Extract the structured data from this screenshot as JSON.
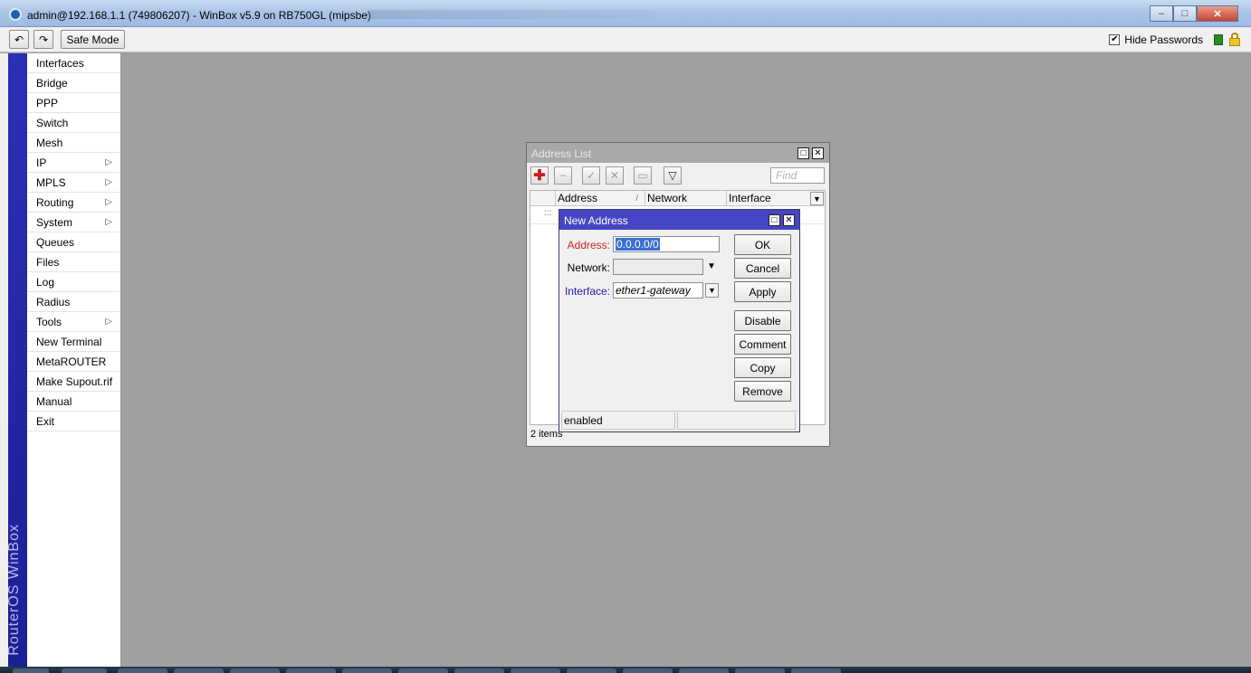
{
  "window": {
    "title": "admin@192.168.1.1 (749806207) - WinBox v5.9 on RB750GL (mipsbe)",
    "buttons": {
      "minimize": "–",
      "maximize": "□",
      "close": "✕"
    }
  },
  "toolbar": {
    "undo_icon": "↶",
    "redo_icon": "↷",
    "safe_mode_label": "Safe Mode",
    "hide_passwords_label": "Hide Passwords",
    "hide_passwords_checked": "✔"
  },
  "sidebar": {
    "brand": "RouterOS WinBox",
    "items": [
      {
        "label": "Interfaces",
        "submenu": ""
      },
      {
        "label": "Bridge",
        "submenu": ""
      },
      {
        "label": "PPP",
        "submenu": ""
      },
      {
        "label": "Switch",
        "submenu": ""
      },
      {
        "label": "Mesh",
        "submenu": ""
      },
      {
        "label": "IP",
        "submenu": "▷"
      },
      {
        "label": "MPLS",
        "submenu": "▷"
      },
      {
        "label": "Routing",
        "submenu": "▷"
      },
      {
        "label": "System",
        "submenu": "▷"
      },
      {
        "label": "Queues",
        "submenu": ""
      },
      {
        "label": "Files",
        "submenu": ""
      },
      {
        "label": "Log",
        "submenu": ""
      },
      {
        "label": "Radius",
        "submenu": ""
      },
      {
        "label": "Tools",
        "submenu": "▷"
      },
      {
        "label": "New Terminal",
        "submenu": ""
      },
      {
        "label": "MetaROUTER",
        "submenu": ""
      },
      {
        "label": "Make Supout.rif",
        "submenu": ""
      },
      {
        "label": "Manual",
        "submenu": ""
      },
      {
        "label": "Exit",
        "submenu": ""
      }
    ]
  },
  "address_list": {
    "title": "Address List",
    "find_placeholder": "Find",
    "columns": [
      "Address",
      "Network",
      "Interface"
    ],
    "sort_marker": "/",
    "row_marker": ":::",
    "status": "2 items"
  },
  "new_address": {
    "title": "New Address",
    "address_label": "Address:",
    "address_value": "0.0.0.0/0",
    "network_label": "Network:",
    "network_value": "",
    "interface_label": "Interface:",
    "interface_value": "ether1-gateway",
    "buttons": {
      "ok": "OK",
      "cancel": "Cancel",
      "apply": "Apply",
      "disable": "Disable",
      "comment": "Comment",
      "copy": "Copy",
      "remove": "Remove"
    },
    "status_left": "enabled",
    "status_right": ""
  },
  "colors": {
    "dialog_title": "#4646c4",
    "inactive_title": "#a9a9a9",
    "required_label": "#cc2222",
    "link_label": "#2222aa",
    "brand_band": "#2b2fb6"
  }
}
